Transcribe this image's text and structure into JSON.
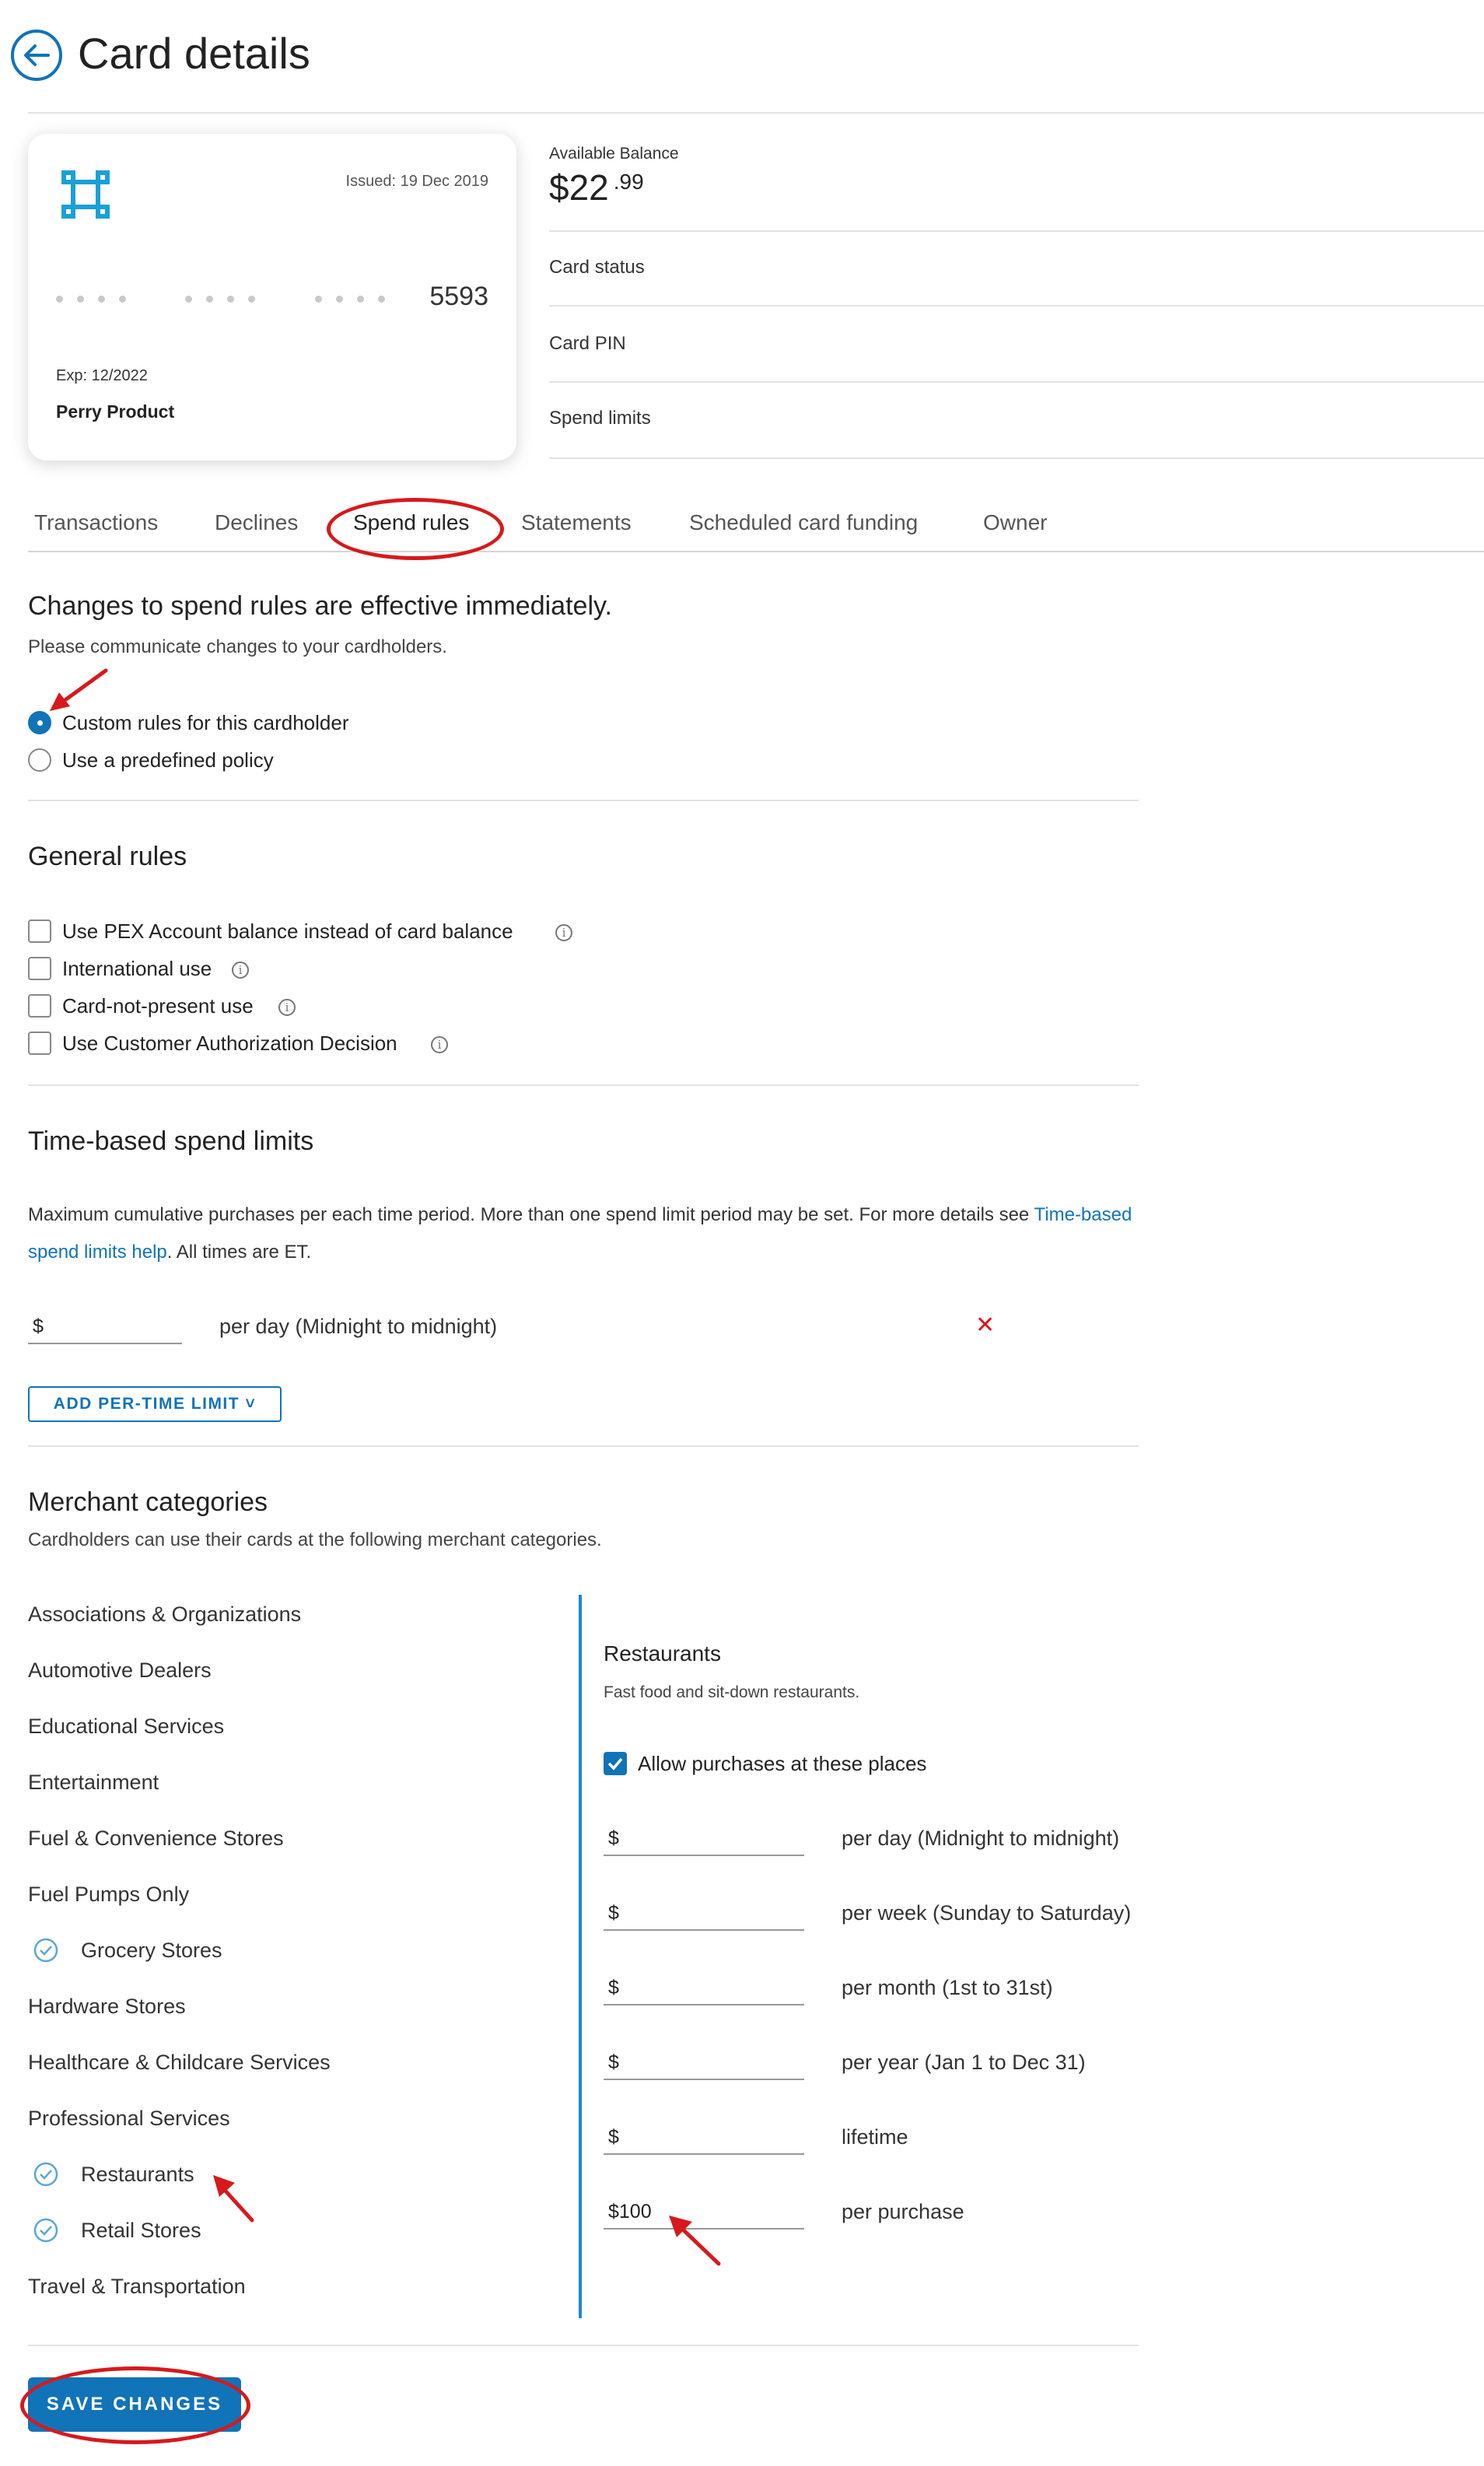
{
  "header": {
    "title": "Card details",
    "back_icon": "arrow-left-icon"
  },
  "card": {
    "issued": "Issued: 19 Dec 2019",
    "masked_groups": [
      "••••",
      "••••",
      "••••"
    ],
    "last4": "5593",
    "exp": "Exp: 12/2022",
    "holder": "Perry Product",
    "logo_icon": "command-key-icon"
  },
  "info": {
    "balance_label": "Available Balance",
    "balance_main": "$22",
    "balance_cents": ".99",
    "status_label": "Card status",
    "pin_label": "Card PIN",
    "limits_label": "Spend limits"
  },
  "tabs": [
    {
      "label": "Transactions"
    },
    {
      "label": "Declines"
    },
    {
      "label": "Spend rules",
      "active": true
    },
    {
      "label": "Statements"
    },
    {
      "label": "Scheduled card funding"
    },
    {
      "label": "Owner"
    }
  ],
  "spend_rules": {
    "heading": "Changes to spend rules are effective immediately.",
    "subheading": "Please communicate changes to your cardholders.",
    "options": [
      {
        "label": "Custom rules for this cardholder",
        "checked": true
      },
      {
        "label": "Use a predefined policy",
        "checked": false
      }
    ]
  },
  "general": {
    "heading": "General rules",
    "items": [
      {
        "label": "Use PEX Account balance instead of card balance",
        "checked": false
      },
      {
        "label": "International use",
        "checked": false
      },
      {
        "label": "Card-not-present use",
        "checked": false
      },
      {
        "label": "Use Customer Authorization Decision",
        "checked": false
      }
    ]
  },
  "time_limits": {
    "heading": "Time-based spend limits",
    "desc_pre": "Maximum cumulative purchases per each time period. More than one spend limit period may be set. For more details see ",
    "desc_link": "Time-based spend limits help",
    "desc_post": ". All times are ET.",
    "field_value": "$",
    "period": "per day (Midnight to midnight)",
    "add_button": "ADD PER-TIME LIMIT"
  },
  "merchant": {
    "heading": "Merchant categories",
    "subheading": "Cardholders can use their cards at the following merchant categories.",
    "categories": [
      {
        "label": "Associations & Organizations",
        "checked": false
      },
      {
        "label": "Automotive Dealers",
        "checked": false
      },
      {
        "label": "Educational Services",
        "checked": false
      },
      {
        "label": "Entertainment",
        "checked": false
      },
      {
        "label": "Fuel & Convenience Stores",
        "checked": false
      },
      {
        "label": "Fuel Pumps Only",
        "checked": false
      },
      {
        "label": "Grocery Stores",
        "checked": true
      },
      {
        "label": "Hardware Stores",
        "checked": false
      },
      {
        "label": "Healthcare & Childcare Services",
        "checked": false
      },
      {
        "label": "Professional Services",
        "checked": false
      },
      {
        "label": "Restaurants",
        "checked": true
      },
      {
        "label": "Retail Stores",
        "checked": true
      },
      {
        "label": "Travel & Transportation",
        "checked": false
      }
    ],
    "detail": {
      "title": "Restaurants",
      "description": "Fast food and sit-down restaurants.",
      "allow_label": "Allow purchases at these places",
      "allow_checked": true,
      "limits": [
        {
          "value": "$",
          "period": "per day (Midnight to midnight)"
        },
        {
          "value": "$",
          "period": "per week (Sunday to Saturday)"
        },
        {
          "value": "$",
          "period": "per month (1st to 31st)"
        },
        {
          "value": "$",
          "period": "per year (Jan 1 to Dec 31)"
        },
        {
          "value": "$",
          "period": "lifetime"
        },
        {
          "value": "$100",
          "period": "per purchase"
        }
      ]
    }
  },
  "save_button": "SAVE CHANGES",
  "colors": {
    "accent": "#1173b8",
    "annotation": "#d7191c",
    "divider": "#e3e3e3"
  }
}
